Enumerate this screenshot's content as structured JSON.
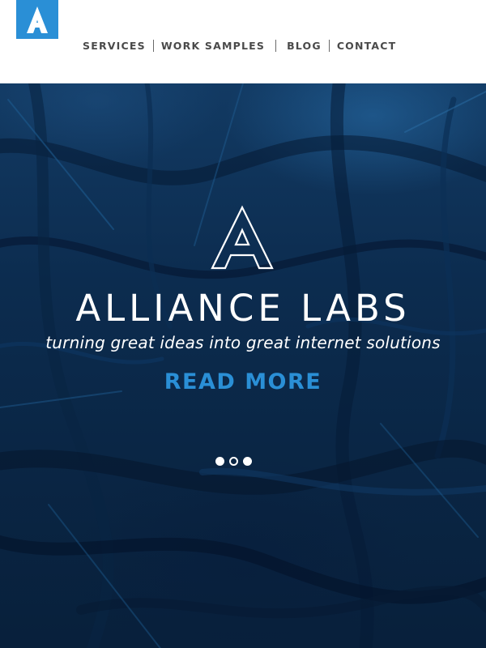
{
  "brand": {
    "logo_letter": "A",
    "accent_color": "#2a8fd6"
  },
  "nav": {
    "items": [
      {
        "label": "SERVICES"
      },
      {
        "label": "WORK SAMPLES"
      },
      {
        "label": "BLOG"
      },
      {
        "label": "CONTACT"
      }
    ]
  },
  "hero": {
    "title": "ALLIANCE LABS",
    "tagline": "turning great ideas into great internet solutions",
    "cta_label": "READ MORE",
    "carousel": {
      "slide_count": 3,
      "active_index": 1
    }
  }
}
